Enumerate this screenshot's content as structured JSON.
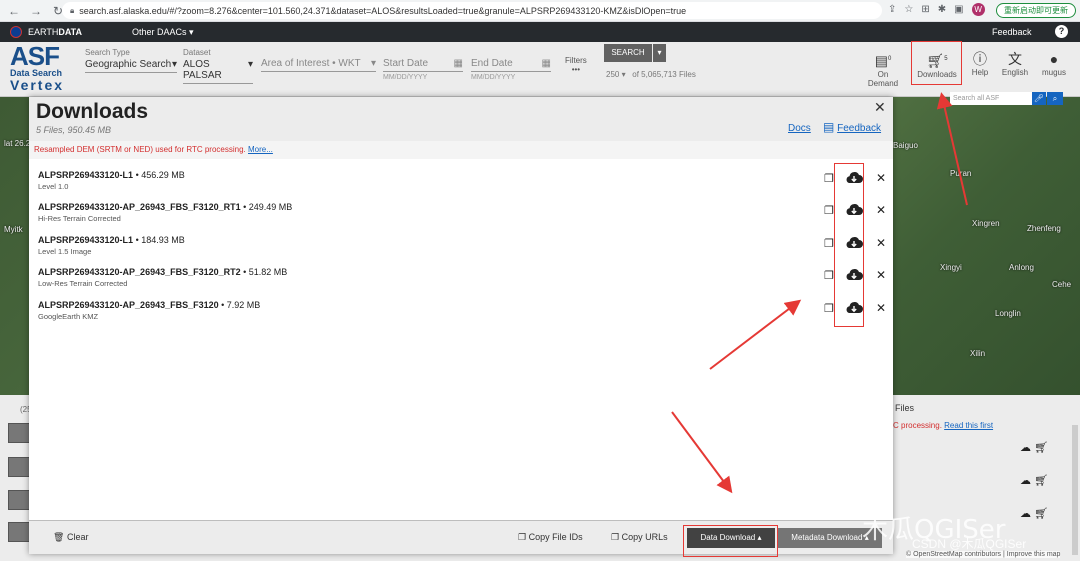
{
  "browser": {
    "url": "search.asf.alaska.edu/#/?zoom=8.276&center=101.560,24.371&dataset=ALOS&resultsLoaded=true&granule=ALPSRP269433120-KMZ&isDlOpen=true",
    "profile_initial": "W",
    "update_label": "重新启动即可更新"
  },
  "earthdata": {
    "brand_prefix": "EARTH",
    "brand_bold": "DATA",
    "other_daacs": "Other DAACs",
    "feedback": "Feedback"
  },
  "header": {
    "logo_asf": "ASF",
    "logo_data_search": "Data Search",
    "logo_vertex": "Vertex",
    "search_type_label": "Search Type",
    "search_type_value": "Geographic Search",
    "dataset_label": "Dataset",
    "dataset_value": "ALOS PALSAR",
    "aoi_placeholder": "Area of Interest • WKT",
    "start_date": "Start Date",
    "end_date": "End Date",
    "date_hint": "MM/DD/YYYY",
    "filters": "Filters",
    "filters_dots": "•••",
    "search_button": "SEARCH",
    "result_limit": "250",
    "result_total": "of 5,065,713 Files",
    "on_demand": "On Demand",
    "on_demand_badge": "0",
    "downloads": "Downloads",
    "downloads_badge": "5",
    "help": "Help",
    "language": "English",
    "user": "mugus"
  },
  "map": {
    "search_placeholder": "Search all ASF",
    "labels": [
      "Baiguo",
      "Puran",
      "Xingren",
      "Zhenfeng",
      "Xingyi",
      "Anlong",
      "Longlin",
      "Xilin",
      "Myitk",
      "Cehe"
    ],
    "lat_label": "lat 26.2"
  },
  "results": {
    "files_label": "Files",
    "count_label": "(25",
    "notice_text": "C processing.",
    "notice_link": "Read this first"
  },
  "modal": {
    "title": "Downloads",
    "subtitle": "5 Files, 950.45 MB",
    "docs": "Docs",
    "feedback": "Feedback",
    "notice": "Resampled DEM (SRTM or NED) used for RTC processing.",
    "notice_more": "More...",
    "items": [
      {
        "name": "ALPSRP269433120-L1",
        "size": "456.29 MB",
        "desc": "Level 1.0"
      },
      {
        "name": "ALPSRP269433120-AP_26943_FBS_F3120_RT1",
        "size": "249.49 MB",
        "desc": "Hi-Res Terrain Corrected"
      },
      {
        "name": "ALPSRP269433120-L1",
        "size": "184.93 MB",
        "desc": "Level 1.5 Image"
      },
      {
        "name": "ALPSRP269433120-AP_26943_FBS_F3120_RT2",
        "size": "51.82 MB",
        "desc": "Low-Res Terrain Corrected"
      },
      {
        "name": "ALPSRP269433120-AP_26943_FBS_F3120",
        "size": "7.92 MB",
        "desc": "GoogleEarth KMZ"
      }
    ],
    "footer": {
      "clear": "Clear",
      "copy_ids": "Copy File IDs",
      "copy_urls": "Copy URLs",
      "data_download": "Data Download",
      "metadata_download": "Metadata Download"
    }
  },
  "watermark": {
    "large": "木瓜QGISer",
    "small": "CSDN @木瓜QGISer"
  },
  "attribution": "© OpenStreetMap contributors | Improve this map",
  "colors": {
    "annotation_red": "#e53935",
    "link_blue": "#1565c0",
    "notice_red": "#d32f2f"
  }
}
